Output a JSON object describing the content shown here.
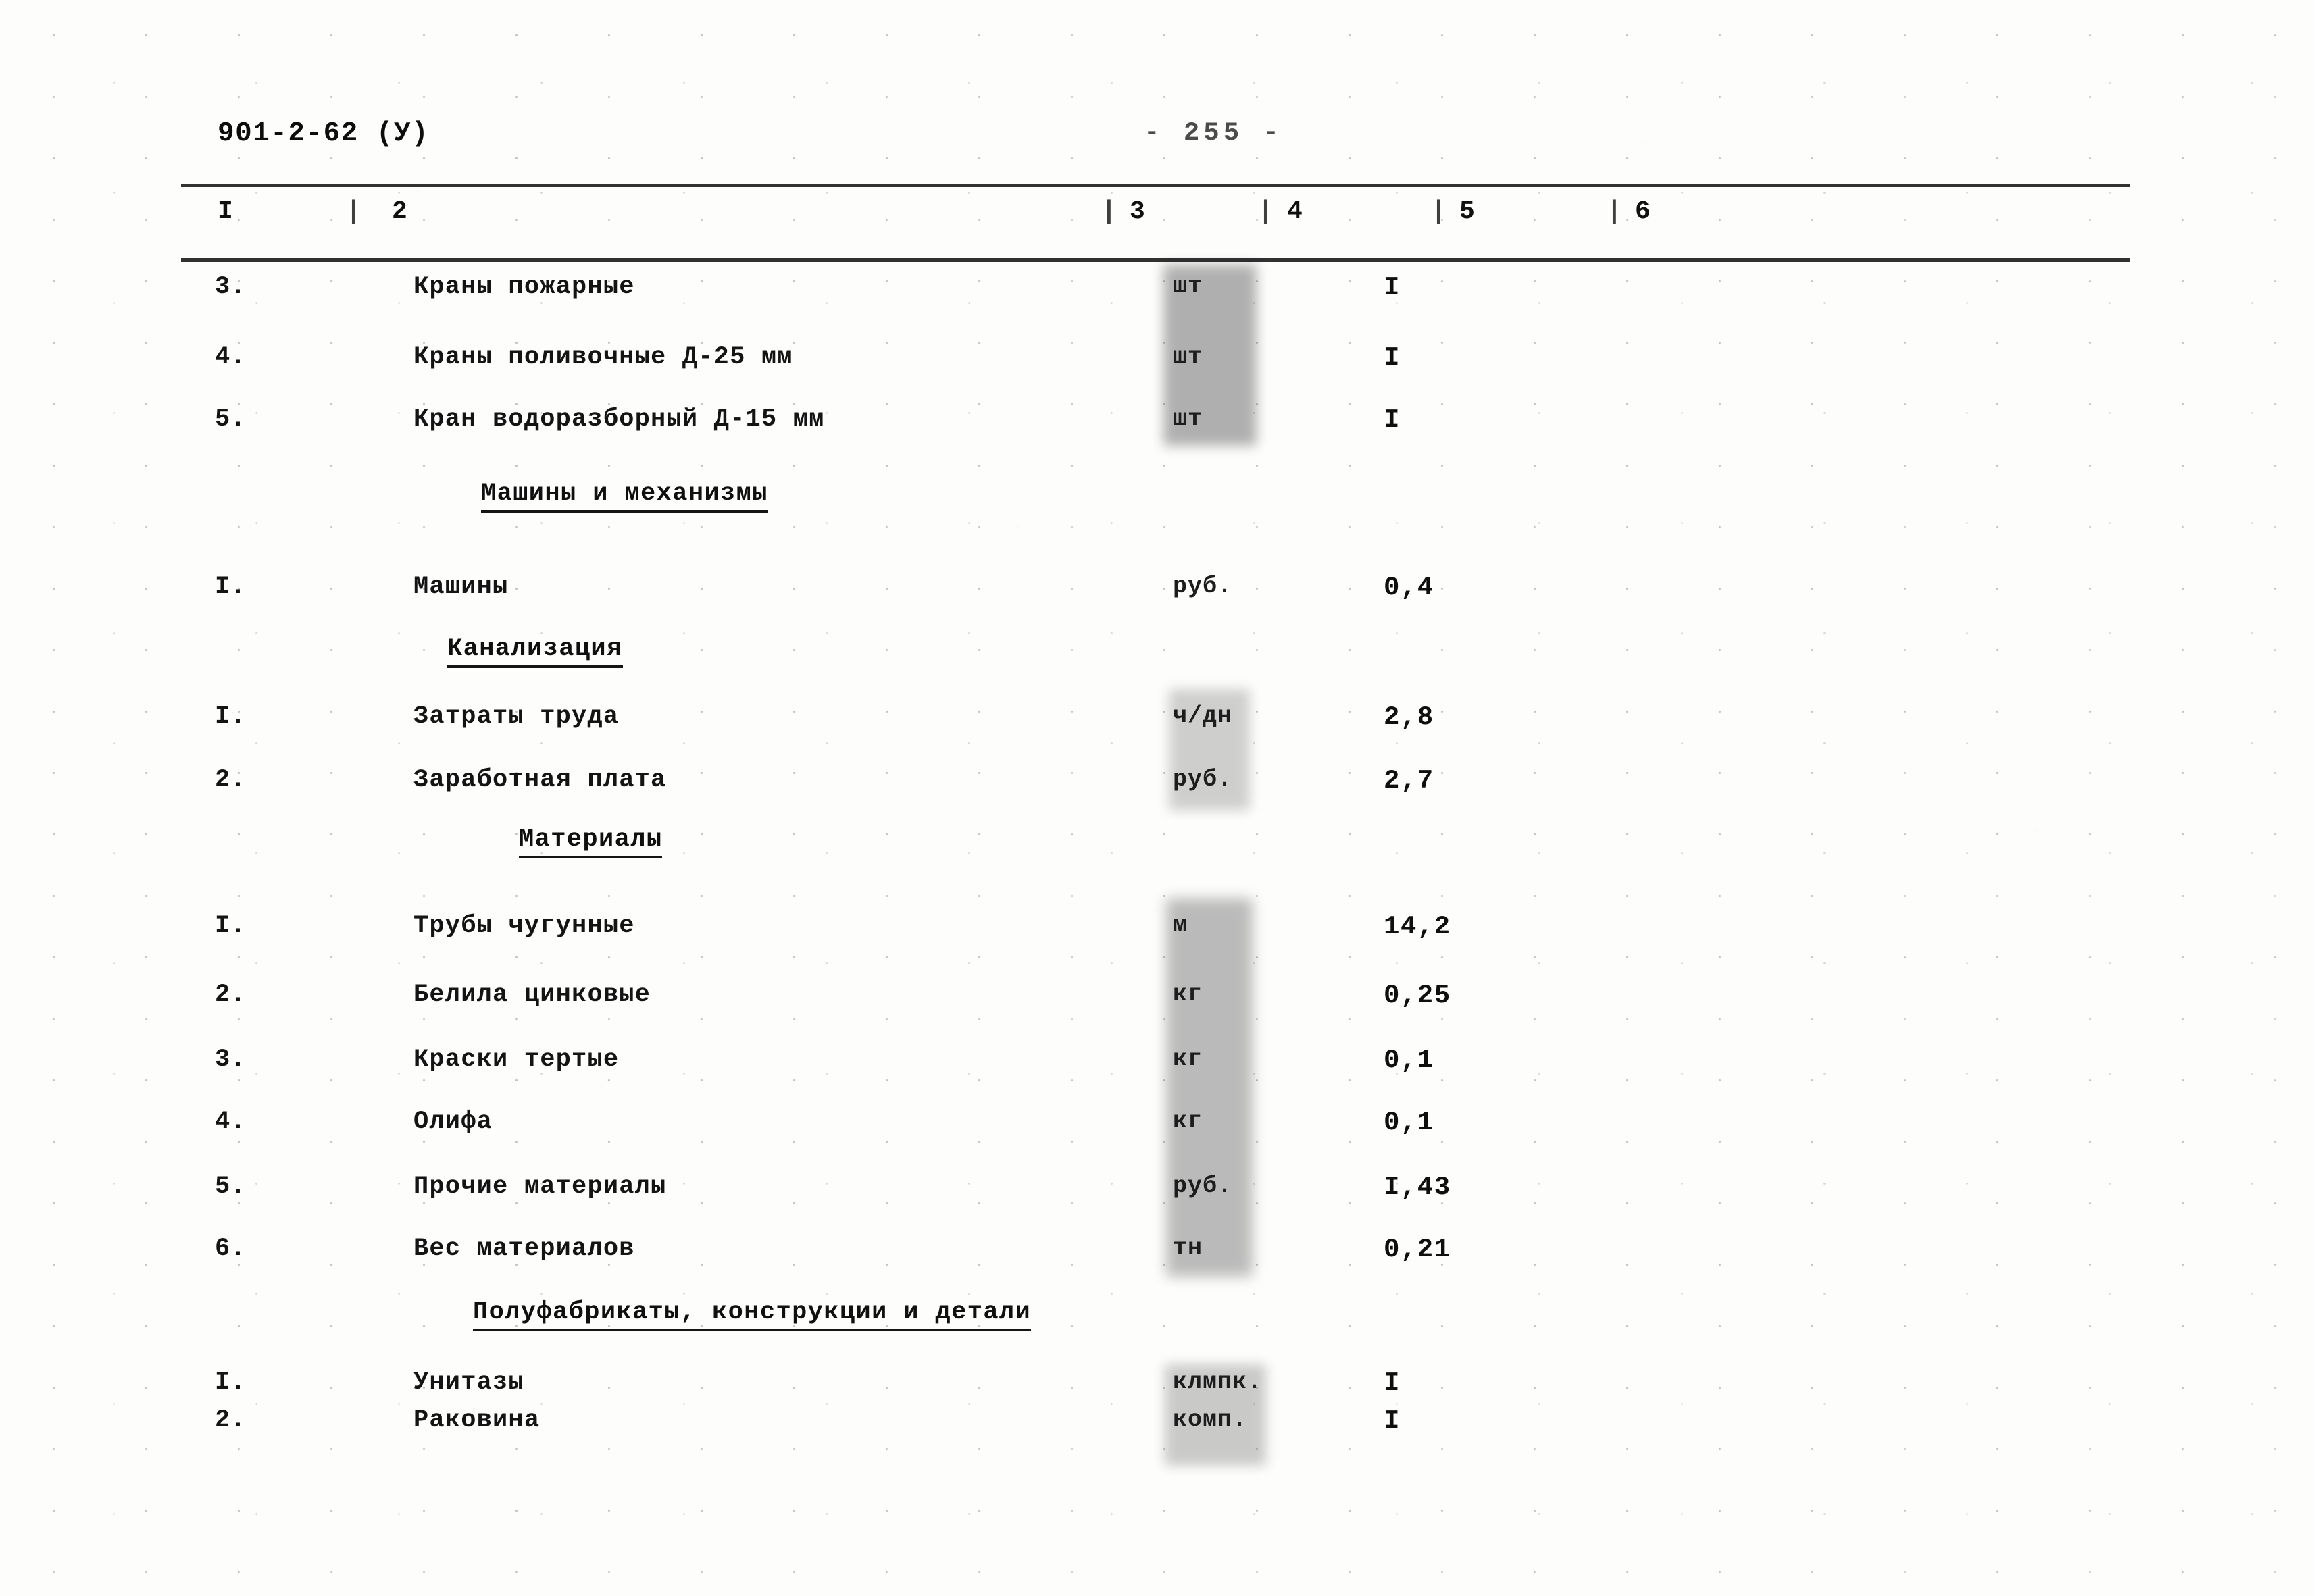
{
  "header": {
    "doc_code": "901-2-62 (У)",
    "page_number": "-  255  -"
  },
  "table": {
    "column_headers": [
      "I",
      "2",
      "3",
      "4",
      "5",
      "6"
    ],
    "column_separator": "|",
    "rows": [
      {
        "kind": "item",
        "num": "3.",
        "name": "Краны пожарные",
        "unit": "шт",
        "value": "I"
      },
      {
        "kind": "item",
        "num": "4.",
        "name": "Краны поливочные Д-25 мм",
        "unit": "шт",
        "value": "I"
      },
      {
        "kind": "item",
        "num": "5.",
        "name": "Кран водоразборный Д-15 мм",
        "unit": "шт",
        "value": "I"
      },
      {
        "kind": "section",
        "title": "Машины и механизмы"
      },
      {
        "kind": "item",
        "num": "I.",
        "name": "Машины",
        "unit": "руб.",
        "value": "0,4"
      },
      {
        "kind": "section",
        "title": "Канализация"
      },
      {
        "kind": "item",
        "num": "I.",
        "name": "Затраты труда",
        "unit": "ч/дн",
        "value": "2,8"
      },
      {
        "kind": "item",
        "num": "2.",
        "name": "Заработная плата",
        "unit": "руб.",
        "value": "2,7"
      },
      {
        "kind": "section",
        "title": "Материалы"
      },
      {
        "kind": "item",
        "num": "I.",
        "name": "Трубы чугунные",
        "unit": "м",
        "value": "14,2"
      },
      {
        "kind": "item",
        "num": "2.",
        "name": "Белила цинковые",
        "unit": "кг",
        "value": "0,25"
      },
      {
        "kind": "item",
        "num": "3.",
        "name": "Краски тертые",
        "unit": "кг",
        "value": "0,1"
      },
      {
        "kind": "item",
        "num": "4.",
        "name": "Олифа",
        "unit": "кг",
        "value": "0,1"
      },
      {
        "kind": "item",
        "num": "5.",
        "name": "Прочие материалы",
        "unit": "руб.",
        "value": "I,43"
      },
      {
        "kind": "item",
        "num": "6.",
        "name": "Вес материалов",
        "unit": "тн",
        "value": "0,21"
      },
      {
        "kind": "section",
        "title": "Полуфабрикаты, конструкции и детали"
      },
      {
        "kind": "item",
        "num": "I.",
        "name": "Унитазы",
        "unit": "клмпк.",
        "value": "I"
      },
      {
        "kind": "item",
        "num": "2.",
        "name": "Раковина",
        "unit": "комп.",
        "value": "I"
      }
    ]
  }
}
